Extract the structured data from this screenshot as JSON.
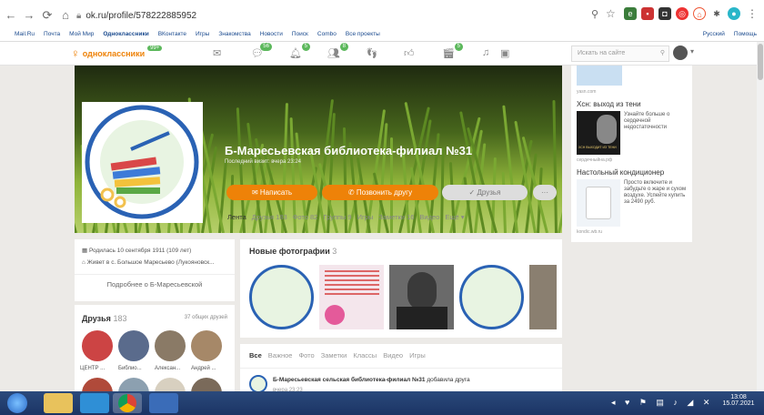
{
  "browser": {
    "url": "ok.ru/profile/578222885952",
    "bookmarks": [
      "Mail.Ru",
      "Почта",
      "Мой Мир",
      "Одноклассники",
      "ВКонтакте",
      "Игры",
      "Знакомства",
      "Новости",
      "Поиск",
      "Combo",
      "Все проекты"
    ]
  },
  "okbar": {
    "brand": "одноклассники",
    "brand_badge": "99+",
    "badges": [
      "56",
      "5",
      "8",
      "5"
    ],
    "search_placeholder": "Искать на сайте",
    "lang": "Русский",
    "help": "Помощь"
  },
  "profile": {
    "name": "Б-Маресьевская библиотека-филиал №31",
    "last_visit": "Последний визит: вчера 23:24",
    "write_btn": "Написать",
    "call_btn": "Позвонить другу",
    "friends_btn": "Друзья",
    "tabs": [
      "Лента",
      "Друзья 183",
      "Фото 82",
      "Группы 9",
      "Игры",
      "Заметки 16",
      "Видео",
      "Ещё"
    ]
  },
  "info": {
    "born": "Родилась 10 сентября 1911 (109 лет)",
    "lives": "Живет в с. Большое Маресьево (Лукояновск...",
    "more": "Подробнее о Б-Маресьевской"
  },
  "friends": {
    "title": "Друзья",
    "count": "183",
    "mutual": "37 общих друзей",
    "names": [
      "ЦЕНТР ...",
      "Библио...",
      "Алексан...",
      "Андрей ..."
    ]
  },
  "photos": {
    "title": "Новые фотографии",
    "count": "3"
  },
  "feed": {
    "tabs": [
      "Все",
      "Важное",
      "Фото",
      "Заметки",
      "Классы",
      "Видео",
      "Игры"
    ],
    "post_author": "Б-Маресьевская сельская библиотека-филиал №31",
    "post_action": "добавила друга",
    "post_time": "вчера 23:23"
  },
  "ads": {
    "ad0_source": "yasn.com",
    "ad1_title": "Хсн: выход из тени",
    "ad1_text": "Узнайте больше о сердечной недостаточности",
    "ad1_img_text": "ХСН ВЫХОДИТ ИЗ ТЕНИ",
    "ad1_source": "сердечныйна.рф",
    "ad2_title": "Настольный кондиционер",
    "ad2_text": "Просто включите и забудьте о жаре и сухом воздухе. Успейте купить за 2490 руб.",
    "ad2_source": "kondic.wb.ru"
  },
  "taskbar": {
    "time": "13:08",
    "date": "15.07.2021"
  }
}
